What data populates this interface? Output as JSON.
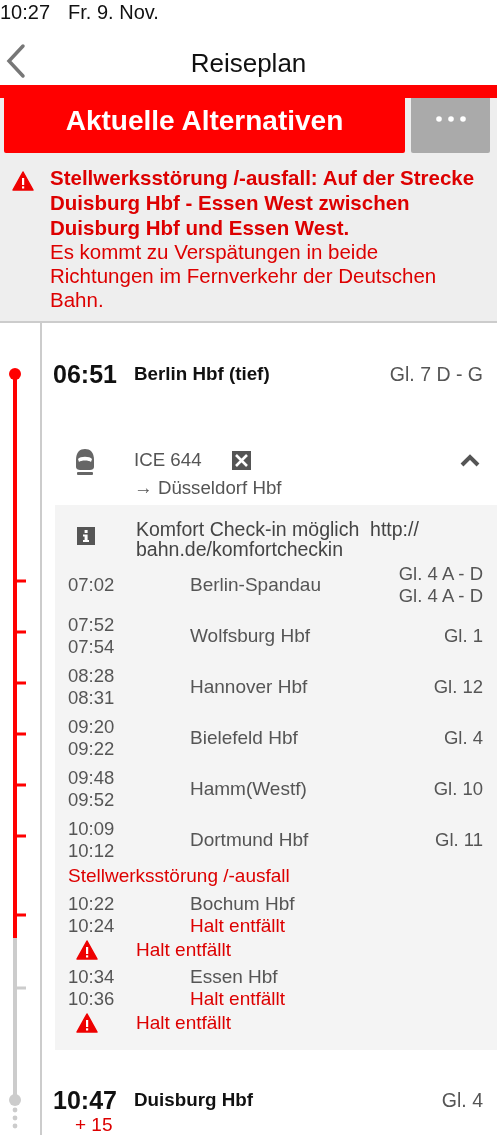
{
  "status_bar": {
    "time": "10:27",
    "date": "Fr. 9. Nov."
  },
  "nav": {
    "title": "Reiseplan"
  },
  "actions": {
    "primary": "Aktuelle Alternativen"
  },
  "alert": {
    "title": "Stellwerksstörung /-ausfall: Auf der Strecke Duisburg Hbf - Essen West zwischen Duisburg Hbf und Essen West.",
    "text": "Es kommt zu Verspätungen in beide Richtungen im Fernverkehr der Deutschen Bahn."
  },
  "journey": {
    "departure": {
      "time": "06:51",
      "station": "Berlin Hbf (tief)",
      "platform": "Gl. 7 D - G",
      "passed": true
    },
    "train": {
      "name": "ICE 644",
      "destination": "→ Düsseldorf Hbf",
      "expanded": true
    },
    "note": "Komfort Check-in möglich  http://bahn.de/komfortcheckin",
    "stops": [
      {
        "kind": "stop",
        "times": [
          "07:02"
        ],
        "station": "Berlin-Spandau",
        "platforms": [
          "Gl. 4 A - D",
          "Gl. 4 A - D"
        ],
        "passed": true
      },
      {
        "kind": "stop",
        "times": [
          "07:52",
          "07:54"
        ],
        "station": "Wolfsburg Hbf",
        "platforms": [
          "Gl. 1"
        ],
        "passed": true
      },
      {
        "kind": "stop",
        "times": [
          "08:28",
          "08:31"
        ],
        "station": "Hannover Hbf",
        "platforms": [
          "Gl. 12"
        ],
        "passed": true
      },
      {
        "kind": "stop",
        "times": [
          "09:20",
          "09:22"
        ],
        "station": "Bielefeld Hbf",
        "platforms": [
          "Gl. 4"
        ],
        "passed": true
      },
      {
        "kind": "stop",
        "times": [
          "09:48",
          "09:52"
        ],
        "station": "Hamm(Westf)",
        "platforms": [
          "Gl. 10"
        ],
        "passed": true
      },
      {
        "kind": "stop",
        "times": [
          "10:09",
          "10:12"
        ],
        "station": "Dortmund Hbf",
        "platforms": [
          "Gl. 11"
        ],
        "passed": true
      },
      {
        "kind": "notice",
        "text": "Stellwerksstörung /-ausfall"
      },
      {
        "kind": "cancelled",
        "times": [
          "10:22",
          "10:24"
        ],
        "station": "Bochum Hbf",
        "status": "Halt entfällt",
        "warning": "Halt entfällt",
        "passed": true
      },
      {
        "kind": "cancelled",
        "times": [
          "10:34",
          "10:36"
        ],
        "station": "Essen Hbf",
        "status": "Halt entfällt",
        "warning": "Halt entfällt",
        "passed": false
      }
    ],
    "arrival": {
      "time": "10:47",
      "delay": "+ 15",
      "station": "Duisburg Hbf",
      "platform": "Gl. 4",
      "passed": false
    }
  }
}
